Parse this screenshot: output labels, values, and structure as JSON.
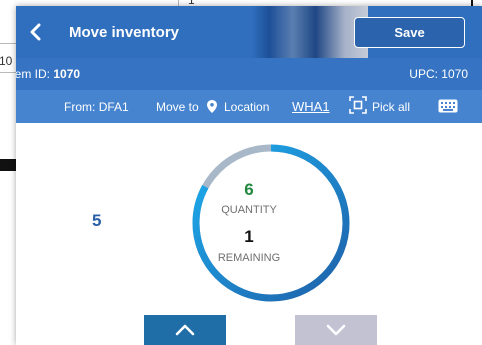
{
  "background": {
    "fragment_top": "1",
    "fragment_left": "10"
  },
  "header": {
    "title": "Move inventory",
    "save_label": "Save",
    "back_icon": "chevron-left-icon"
  },
  "item_row": {
    "item_label": "Item ID:",
    "item_value": "1070",
    "upc_label": "UPC:",
    "upc_value": "1070"
  },
  "location_row": {
    "from_label": "From:",
    "from_value": "DFA1",
    "move_to_label": "Move to",
    "location_label": "Location",
    "location_value": "WHA1",
    "pick_all_label": "Pick all",
    "icons": [
      "location-pin-icon",
      "scan-icon",
      "keyboard-icon"
    ]
  },
  "counter": {
    "side_value": "5",
    "quantity_value": "6",
    "quantity_label": "QUANTITY",
    "remaining_value": "1",
    "remaining_label": "REMAINING",
    "progress_fraction": 0.83
  },
  "colors": {
    "header_dark": "#2f6fbd",
    "header_mid": "#3674c3",
    "header_light": "#4684d0",
    "ring_track": "#a8b8c8",
    "ring_fill": "#19a4e8",
    "quantity_green": "#23883f",
    "up_button": "#1f6ea8",
    "down_button": "#c3c2d2"
  }
}
